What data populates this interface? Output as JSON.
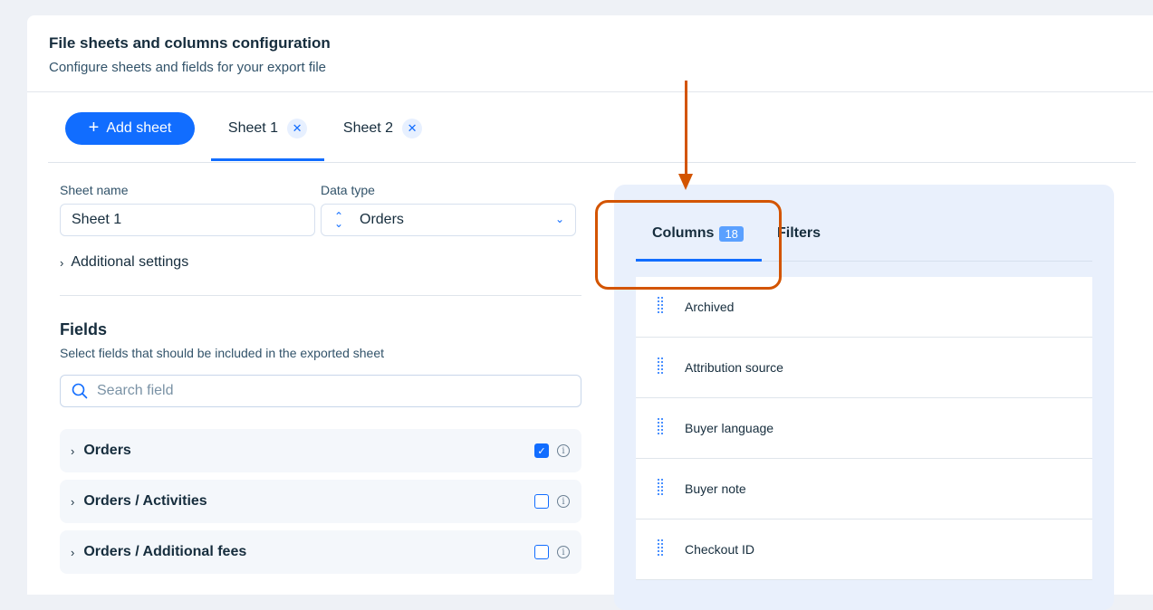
{
  "header": {
    "title": "File sheets and columns configuration",
    "subtitle": "Configure sheets and fields for your export file"
  },
  "toolbar": {
    "add_sheet_label": "Add sheet",
    "tabs": [
      {
        "label": "Sheet 1",
        "active": true
      },
      {
        "label": "Sheet 2",
        "active": false
      }
    ]
  },
  "sheet_form": {
    "sheet_name_label": "Sheet name",
    "sheet_name_value": "Sheet 1",
    "data_type_label": "Data type",
    "data_type_value": "Orders",
    "additional_settings_label": "Additional settings"
  },
  "fields": {
    "title": "Fields",
    "subtitle": "Select fields that should be included in the exported sheet",
    "search_placeholder": "Search field",
    "groups": [
      {
        "label": "Orders",
        "checked": true
      },
      {
        "label": "Orders / Activities",
        "checked": false
      },
      {
        "label": "Orders / Additional fees",
        "checked": false
      }
    ]
  },
  "right_panel": {
    "columns_tab_label": "Columns",
    "columns_count": "18",
    "filters_tab_label": "Filters",
    "columns": [
      "Archived",
      "Attribution source",
      "Buyer language",
      "Buyer note",
      "Checkout ID"
    ]
  },
  "colors": {
    "accent": "#116dff",
    "annotation": "#d35400",
    "panel_bg": "#e9f0fc"
  }
}
